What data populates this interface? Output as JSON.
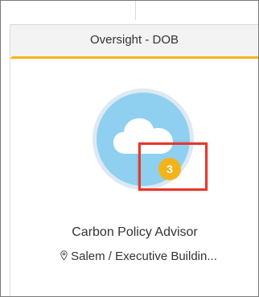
{
  "header": {
    "title": "Oversight - DOB"
  },
  "card": {
    "avatar_icon": "cloud-icon",
    "badge_count": "3",
    "title": "Carbon Policy Advisor",
    "location_icon": "location-pin-icon",
    "location": "Salem / Executive Buildin..."
  },
  "colors": {
    "accent": "#f3b41b",
    "avatar_bg": "#8fd0f0",
    "highlight": "#e8372c"
  }
}
